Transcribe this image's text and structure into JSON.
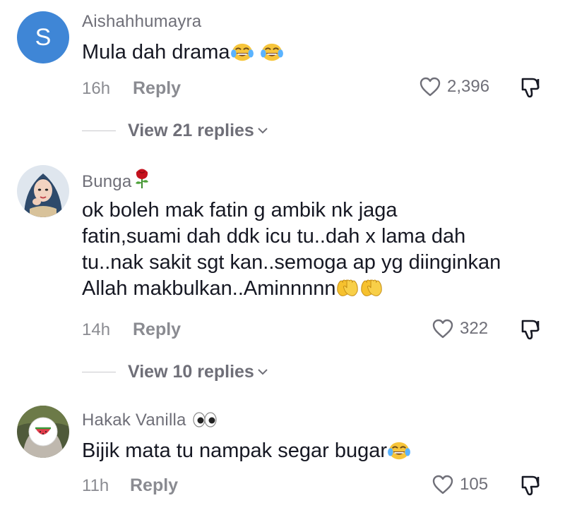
{
  "comments": [
    {
      "username": "Aishahhumayra",
      "avatar_letter": "S",
      "text": "Mula dah drama",
      "time": "16h",
      "reply_label": "Reply",
      "likes": "2,396",
      "view_replies": "View 21 replies"
    },
    {
      "username": "Bunga",
      "text_lines": [
        "ok boleh mak fatin g ambik nk jaga",
        "fatin,suami dah ddk icu tu..dah x lama dah",
        "tu..nak sakit sgt kan..semoga ap yg diinginkan",
        "Allah makbulkan..Aminnnnn"
      ],
      "time": "14h",
      "reply_label": "Reply",
      "likes": "322",
      "view_replies": "View 10 replies"
    },
    {
      "username": "Hakak Vanilla",
      "text": "Bijik mata tu nampak segar bugar",
      "time": "11h",
      "reply_label": "Reply",
      "likes": "105"
    }
  ],
  "icons": {
    "like": "heart-outline-icon",
    "dislike": "thumbs-down-outline-icon",
    "chevron": "chevron-down-icon"
  },
  "colors": {
    "avatar_blue": "#3f86d6",
    "secondary_text": "#8a8b91"
  }
}
